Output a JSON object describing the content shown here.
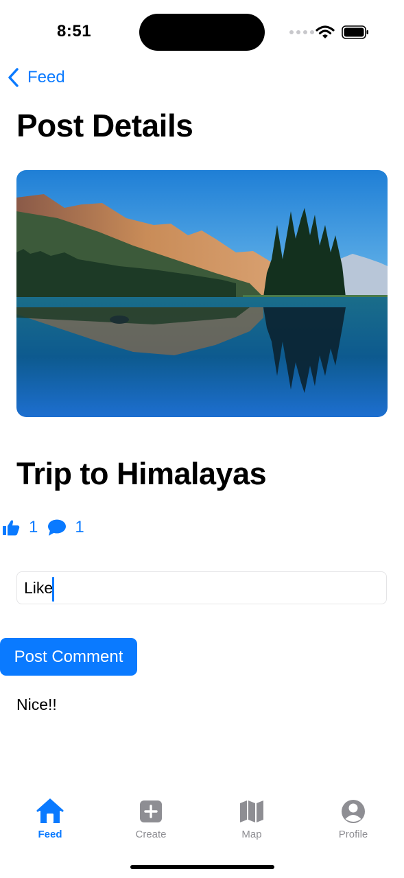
{
  "status_bar": {
    "time": "8:51"
  },
  "nav": {
    "back_label": "Feed",
    "title": "Post Details"
  },
  "post": {
    "title": "Trip to Himalayas",
    "likes": "1",
    "comments_count": "1"
  },
  "comment_input": {
    "value": "Like",
    "placeholder": ""
  },
  "post_button_label": "Post Comment",
  "comments": [
    "Nice!!"
  ],
  "tabbar": {
    "items": [
      {
        "label": "Feed",
        "icon": "house-icon",
        "active": true
      },
      {
        "label": "Create",
        "icon": "plus-square-icon",
        "active": false
      },
      {
        "label": "Map",
        "icon": "map-icon",
        "active": false
      },
      {
        "label": "Profile",
        "icon": "person-circle-icon",
        "active": false
      }
    ]
  },
  "colors": {
    "accent": "#0a7aff",
    "inactive": "#8e8e93"
  }
}
